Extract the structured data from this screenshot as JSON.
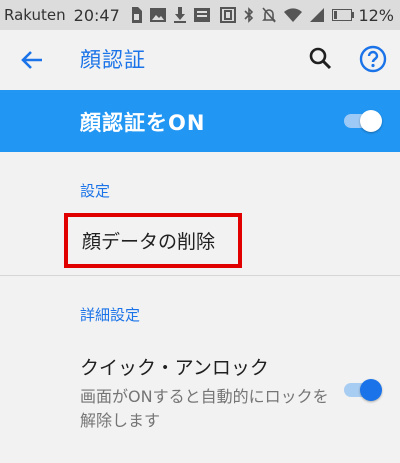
{
  "status_bar": {
    "carrier": "Rakuten",
    "time": "20:47",
    "battery_percent": "12%",
    "icons": [
      "sim-card-icon",
      "image-icon",
      "download-icon",
      "message-icon",
      "nfc-icon",
      "bluetooth-icon",
      "mute-icon",
      "wifi-icon",
      "signal-icon",
      "battery-icon"
    ]
  },
  "toolbar": {
    "title": "顔認証"
  },
  "banner": {
    "label": "顔認証をON",
    "toggle_on": true
  },
  "sections": [
    {
      "header": "設定",
      "items": [
        {
          "label": "顔データの削除"
        }
      ]
    },
    {
      "header": "詳細設定",
      "items": [
        {
          "label": "クイック・アンロック",
          "summary": "画面がONすると自動的にロックを解除します",
          "toggle_on": true
        }
      ]
    }
  ],
  "colors": {
    "accent": "#1a73e8",
    "banner": "#2196f3",
    "highlight_box": "#e00000"
  }
}
